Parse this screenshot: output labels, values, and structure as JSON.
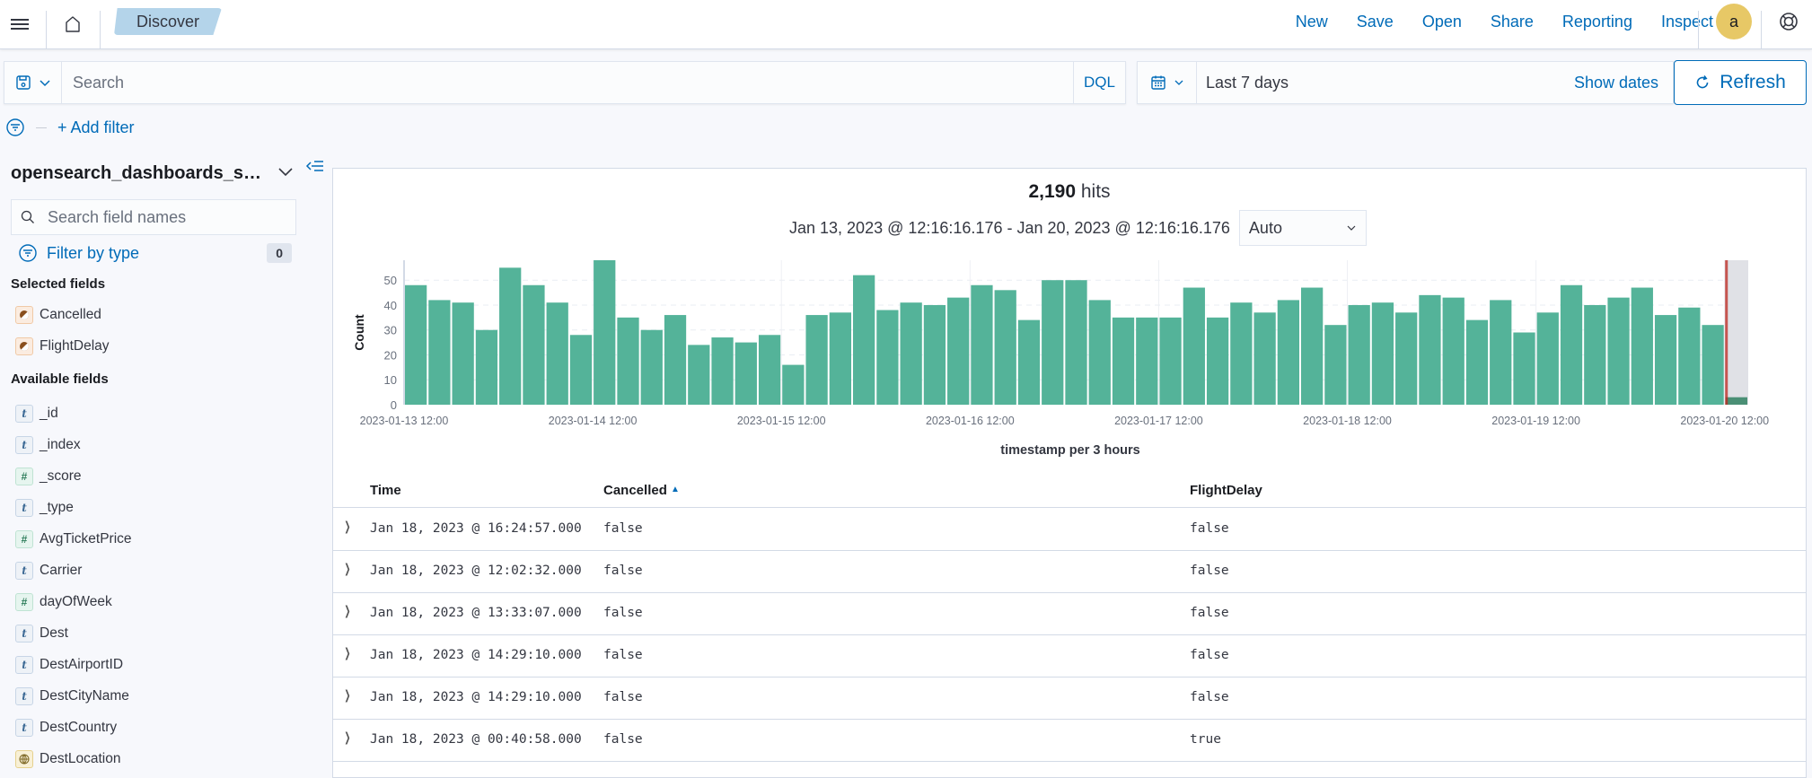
{
  "topbar": {
    "menu_icon": "hamburger-menu-icon",
    "home_icon": "home-icon",
    "breadcrumb": "Discover",
    "links": [
      "New",
      "Save",
      "Open",
      "Share",
      "Reporting",
      "Inspect"
    ],
    "avatar_letter": "a",
    "help_icon": "help-lifebuoy-icon"
  },
  "query": {
    "placeholder": "Search",
    "language": "DQL",
    "date_range": "Last 7 days",
    "show_dates": "Show dates",
    "refresh": "Refresh"
  },
  "filters": {
    "add_filter": "+ Add filter"
  },
  "sidebar": {
    "index_pattern": "opensearch_dashboards_sa...",
    "search_placeholder": "Search field names",
    "filter_by_type": "Filter by type",
    "filter_count": "0",
    "selected_label": "Selected fields",
    "selected_fields": [
      {
        "name": "Cancelled",
        "type": "boolean"
      },
      {
        "name": "FlightDelay",
        "type": "boolean"
      }
    ],
    "available_label": "Available fields",
    "available_fields": [
      {
        "name": "_id",
        "type": "string"
      },
      {
        "name": "_index",
        "type": "string"
      },
      {
        "name": "_score",
        "type": "number"
      },
      {
        "name": "_type",
        "type": "string"
      },
      {
        "name": "AvgTicketPrice",
        "type": "number"
      },
      {
        "name": "Carrier",
        "type": "string"
      },
      {
        "name": "dayOfWeek",
        "type": "number"
      },
      {
        "name": "Dest",
        "type": "string"
      },
      {
        "name": "DestAirportID",
        "type": "string"
      },
      {
        "name": "DestCityName",
        "type": "string"
      },
      {
        "name": "DestCountry",
        "type": "string"
      },
      {
        "name": "DestLocation",
        "type": "geo_point"
      }
    ]
  },
  "summary": {
    "hits_count": "2,190",
    "hits_label": "hits",
    "time_range": "Jan 13, 2023 @ 12:16:16.176 - Jan 20, 2023 @ 12:16:16.176",
    "interval": "Auto"
  },
  "chart_data": {
    "type": "bar",
    "title": "",
    "xlabel": "timestamp per 3 hours",
    "ylabel": "Count",
    "ylim": [
      0,
      58
    ],
    "yticks": [
      0,
      10,
      20,
      30,
      40,
      50
    ],
    "x_start": "2023-01-13 12:00",
    "bucket_hours": 3,
    "xticks": [
      "2023-01-13 12:00",
      "2023-01-14 12:00",
      "2023-01-15 12:00",
      "2023-01-16 12:00",
      "2023-01-17 12:00",
      "2023-01-18 12:00",
      "2023-01-19 12:00",
      "2023-01-20 12:00"
    ],
    "values": [
      48,
      42,
      41,
      30,
      55,
      48,
      41,
      28,
      58,
      35,
      30,
      36,
      24,
      27,
      25,
      28,
      16,
      36,
      37,
      52,
      38,
      41,
      40,
      43,
      48,
      46,
      34,
      50,
      50,
      42,
      35,
      35,
      35,
      47,
      35,
      41,
      37,
      42,
      47,
      32,
      40,
      41,
      37,
      44,
      43,
      34,
      42,
      29,
      37,
      48,
      40,
      43,
      47,
      36,
      39,
      32,
      3
    ],
    "partial_bucket_index": 56,
    "now_marker": "2023-01-20 12:16",
    "bar_color": "#54b399",
    "partial_color": "#4a8f75",
    "now_line_color": "#bd271e",
    "grid": true,
    "legend": "none"
  },
  "table": {
    "columns": [
      "Time",
      "Cancelled",
      "FlightDelay"
    ],
    "sort_indicator": "▲",
    "rows": [
      {
        "time": "Jan 18, 2023 @ 16:24:57.000",
        "cancelled": "false",
        "delay": "false"
      },
      {
        "time": "Jan 18, 2023 @ 12:02:32.000",
        "cancelled": "false",
        "delay": "false"
      },
      {
        "time": "Jan 18, 2023 @ 13:33:07.000",
        "cancelled": "false",
        "delay": "false"
      },
      {
        "time": "Jan 18, 2023 @ 14:29:10.000",
        "cancelled": "false",
        "delay": "false"
      },
      {
        "time": "Jan 18, 2023 @ 14:29:10.000",
        "cancelled": "false",
        "delay": "false"
      },
      {
        "time": "Jan 18, 2023 @ 00:40:58.000",
        "cancelled": "false",
        "delay": "true"
      }
    ]
  }
}
